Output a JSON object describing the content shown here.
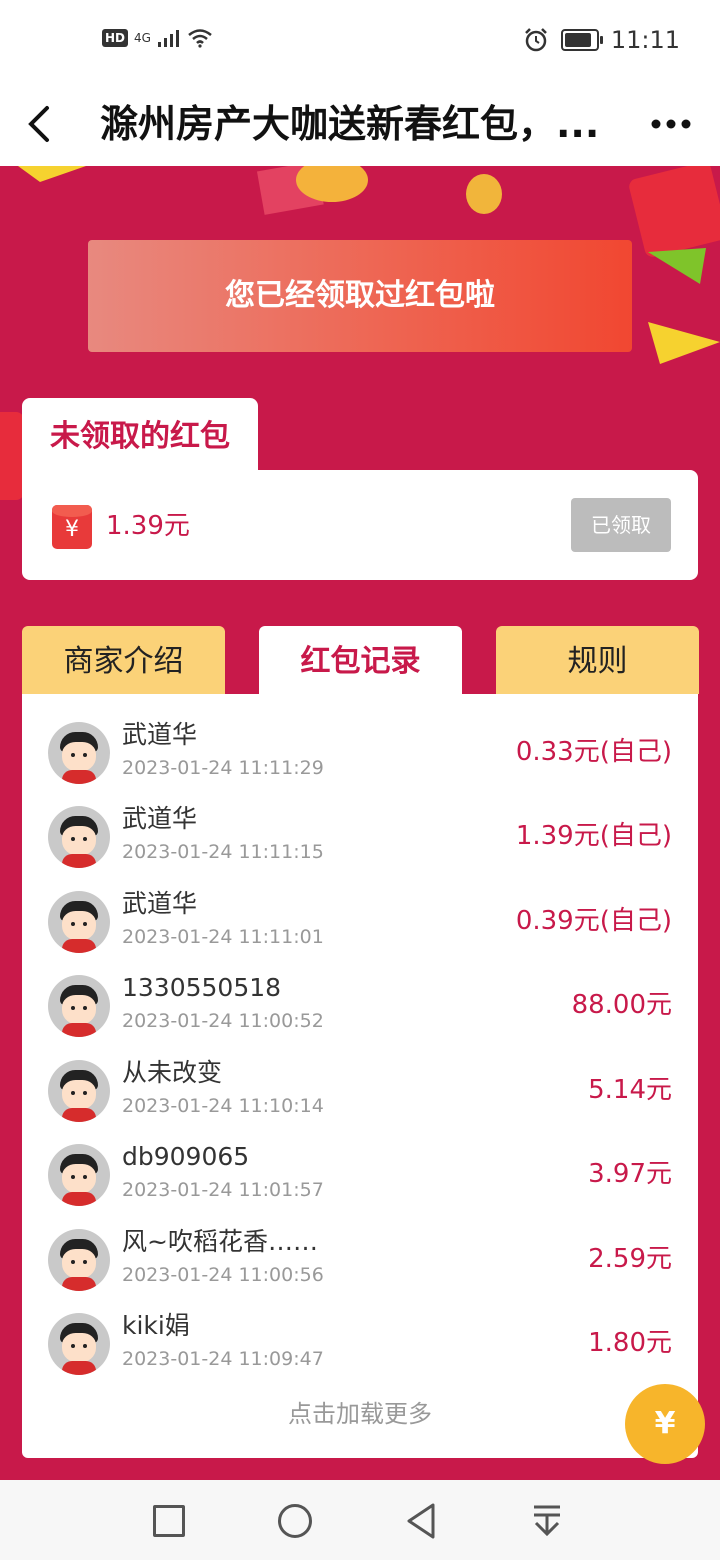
{
  "status_bar": {
    "left_badges": [
      "HD",
      "4G"
    ],
    "time": "11:11",
    "icons": [
      "signal-icon",
      "wifi-icon",
      "alarm-icon",
      "battery-icon"
    ]
  },
  "header": {
    "back_icon": "‹",
    "title": "滁州房产大咖送新春红包，...",
    "more_icon": "•••"
  },
  "banner": {
    "text": "您已经领取过红包啦"
  },
  "unclaimed": {
    "tab_label": "未领取的红包",
    "amount": "1.39元",
    "button_label": "已领取"
  },
  "tabs": [
    {
      "label": "商家介绍"
    },
    {
      "label": "红包记录",
      "active": true
    },
    {
      "label": "规则"
    }
  ],
  "records": [
    {
      "name": "武道华",
      "time": "2023-01-24 11:11:29",
      "amount": "0.33元(自己)"
    },
    {
      "name": "武道华",
      "time": "2023-01-24 11:11:15",
      "amount": "1.39元(自己)"
    },
    {
      "name": "武道华",
      "time": "2023-01-24 11:11:01",
      "amount": "0.39元(自己)"
    },
    {
      "name": "1330550518",
      "time": "2023-01-24 11:00:52",
      "amount": "88.00元"
    },
    {
      "name": "从未改变",
      "time": "2023-01-24 11:10:14",
      "amount": "5.14元"
    },
    {
      "name": "db909065",
      "time": "2023-01-24 11:01:57",
      "amount": "3.97元"
    },
    {
      "name": "风~吹稻花香……",
      "time": "2023-01-24 11:00:56",
      "amount": "2.59元"
    },
    {
      "name": "kiki娟",
      "time": "2023-01-24 11:09:47",
      "amount": "1.80元"
    }
  ],
  "load_more": "点击加载更多",
  "float_button": {
    "icon": "money-bag-icon",
    "glyph": "¥"
  },
  "colors": {
    "primary": "#c8194a",
    "tab_inactive": "#fbd278",
    "banner_end": "#f14731"
  }
}
